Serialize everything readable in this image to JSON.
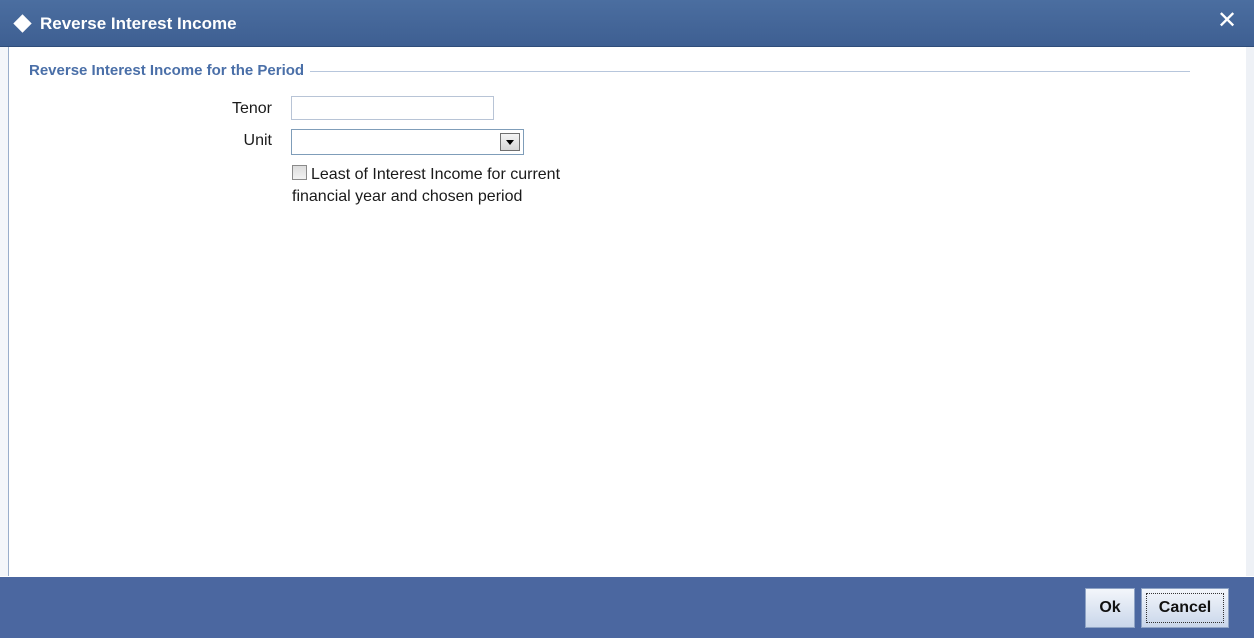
{
  "window": {
    "title": "Reverse Interest Income",
    "close_glyph": "✕"
  },
  "section": {
    "legend": "Reverse Interest Income for the Period"
  },
  "form": {
    "tenor_label": "Tenor",
    "tenor_value": "",
    "unit_label": "Unit",
    "unit_value": "",
    "least_checkbox_label": "Least of Interest Income for current financial year and chosen period",
    "least_checked": false
  },
  "footer": {
    "ok_label": "Ok",
    "cancel_label": "Cancel"
  },
  "colors": {
    "titlebar": "#4b6ea0",
    "footer": "#4b67a0",
    "legend_text": "#4a6fa8"
  },
  "icons": {
    "title_icon": "diamond-icon",
    "close_icon": "close-icon",
    "dropdown_icon": "chevron-down-icon"
  }
}
